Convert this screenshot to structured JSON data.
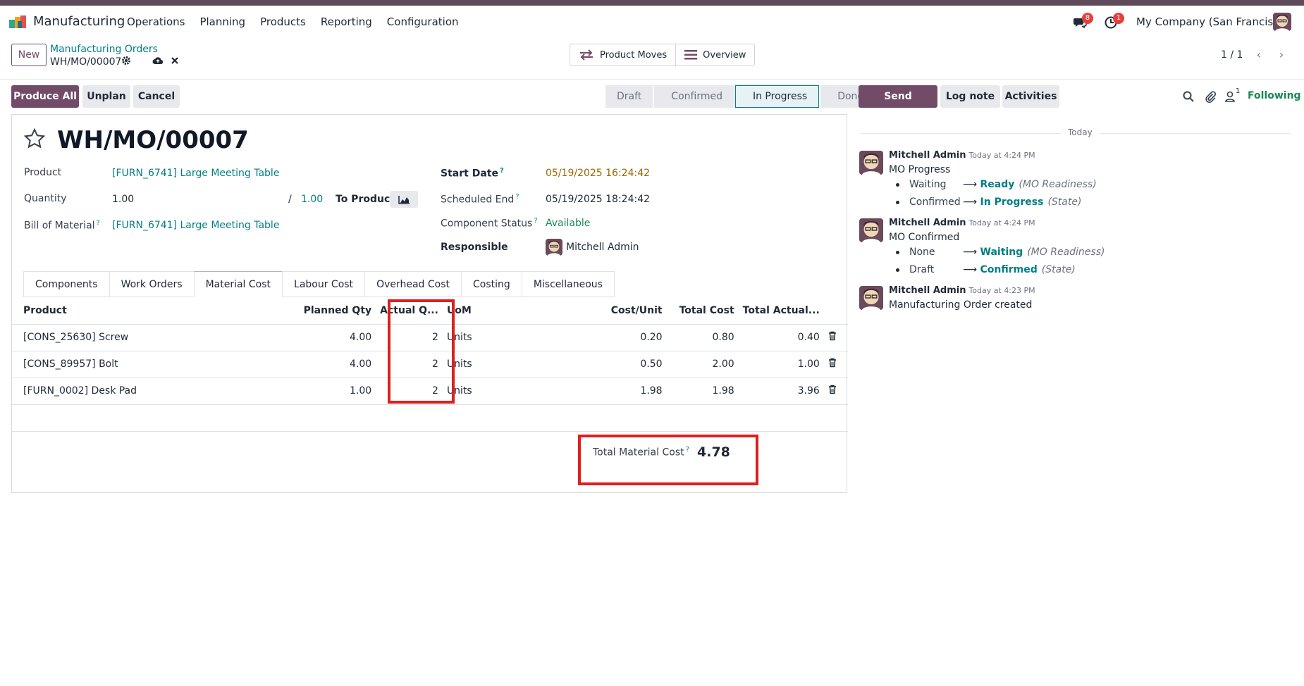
{
  "app": {
    "name": "Manufacturing"
  },
  "nav": {
    "items": [
      "Operations",
      "Planning",
      "Products",
      "Reporting",
      "Configuration"
    ]
  },
  "systray": {
    "messages_count": "8",
    "activities_count": "1",
    "company": "My Company (San Francisco)"
  },
  "control_panel": {
    "new_label": "New",
    "breadcrumb_parent": "Manufacturing Orders",
    "breadcrumb_current": "WH/MO/00007",
    "smart_buttons": [
      "Product Moves",
      "Overview"
    ],
    "pager": "1 / 1"
  },
  "actions": {
    "produce_all": "Produce All",
    "unplan": "Unplan",
    "cancel": "Cancel"
  },
  "stages": {
    "items": [
      "Draft",
      "Confirmed",
      "In Progress",
      "Done"
    ],
    "active": "In Progress"
  },
  "form": {
    "title": "WH/MO/00007",
    "product_label": "Product",
    "product_value": "[FURN_6741] Large Meeting Table",
    "quantity_label": "Quantity",
    "quantity_value": "1.00",
    "quantity_slash": "/",
    "quantity_total": "1.00",
    "to_produce": "To Produce",
    "bom_label": "Bill of Material",
    "bom_value": "[FURN_6741] Large Meeting Table",
    "start_date_label": "Start Date",
    "start_date_value": "05/19/2025 16:24:42",
    "scheduled_end_label": "Scheduled End",
    "scheduled_end_value": "05/19/2025 18:24:42",
    "component_status_label": "Component Status",
    "component_status_value": "Available",
    "responsible_label": "Responsible",
    "responsible_value": "Mitchell Admin",
    "help_mark": "?"
  },
  "tabs": {
    "items": [
      "Components",
      "Work Orders",
      "Material Cost",
      "Labour Cost",
      "Overhead Cost",
      "Costing",
      "Miscellaneous"
    ],
    "active": "Material Cost"
  },
  "table": {
    "headers": [
      "Product",
      "Planned Qty",
      "Actual Q...",
      "UoM",
      "Cost/Unit",
      "Total Cost",
      "Total Actual..."
    ],
    "rows": [
      [
        "[CONS_25630] Screw",
        "4.00",
        "2",
        "Units",
        "0.20",
        "0.80",
        "0.40"
      ],
      [
        "[CONS_89957] Bolt",
        "4.00",
        "2",
        "Units",
        "0.50",
        "2.00",
        "1.00"
      ],
      [
        "[FURN_0002] Desk Pad",
        "1.00",
        "2",
        "Units",
        "1.98",
        "1.98",
        "3.96"
      ]
    ]
  },
  "totals": {
    "label": "Total Material Cost",
    "value": "4.78"
  },
  "chatter": {
    "send_message": "Send message",
    "log_note": "Log note",
    "activities": "Activities",
    "followers_count": "1",
    "following": "Following",
    "date_separator": "Today",
    "messages": [
      {
        "author": "Mitchell Admin",
        "time": "Today at 4:24 PM",
        "body": "MO Progress",
        "changes": [
          {
            "old": "Waiting",
            "new": "Ready",
            "field": "(MO Readiness)"
          },
          {
            "old": "Confirmed",
            "new": "In Progress",
            "field": "(State)"
          }
        ]
      },
      {
        "author": "Mitchell Admin",
        "time": "Today at 4:24 PM",
        "body": "MO Confirmed",
        "changes": [
          {
            "old": "None",
            "new": "Waiting",
            "field": "(MO Readiness)"
          },
          {
            "old": "Draft",
            "new": "Confirmed",
            "field": "(State)"
          }
        ]
      },
      {
        "author": "Mitchell Admin",
        "time": "Today at 4:23 PM",
        "body": "Manufacturing Order created",
        "changes": []
      }
    ]
  },
  "colors": {
    "brand": "#714b67",
    "link": "#017e84",
    "highlight": "#e01e1e",
    "success": "#198754"
  }
}
